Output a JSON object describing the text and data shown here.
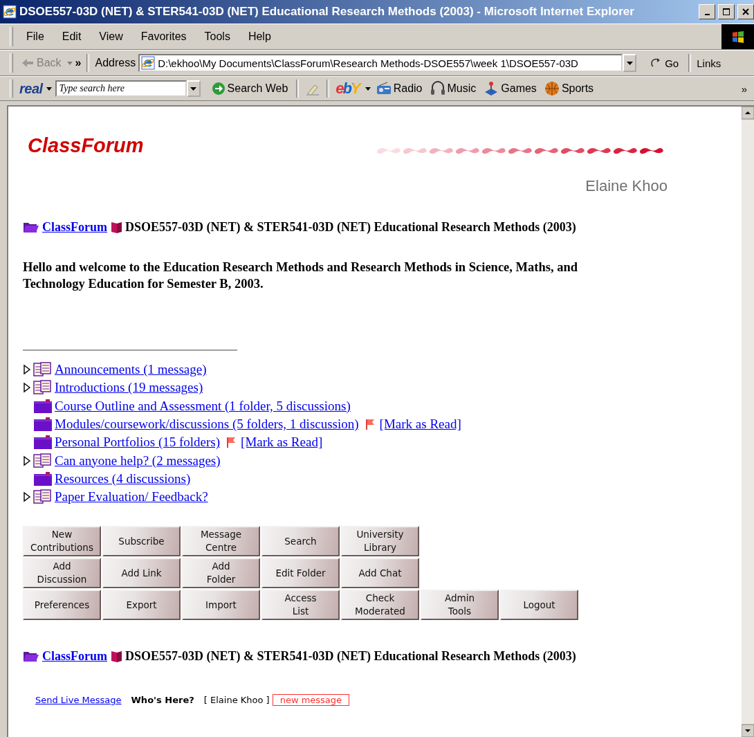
{
  "window": {
    "title": "DSOE557-03D (NET) & STER541-03D (NET) Educational Research Methods (2003) - Microsoft Internet Explorer"
  },
  "menu": [
    "File",
    "Edit",
    "View",
    "Favorites",
    "Tools",
    "Help"
  ],
  "address_bar": {
    "back": {
      "label": "Back",
      "disabled": true
    },
    "overflow": "»",
    "label": "Address",
    "value": "D:\\ekhoo\\My Documents\\ClassForum\\Research Methods-DSOE557\\week 1\\DSOE557-03D",
    "go": "Go",
    "links": "Links"
  },
  "search_toolbar": {
    "logo": "real",
    "search": {
      "placeholder": "Type search here"
    },
    "search_button": "Search Web",
    "ebay_logo": "ebY",
    "items": [
      {
        "label": "Radio",
        "kind": "radio"
      },
      {
        "label": "Music",
        "kind": "music"
      },
      {
        "label": "Games",
        "kind": "games"
      },
      {
        "label": "Sports",
        "kind": "sports"
      }
    ],
    "overflow": "»"
  },
  "page": {
    "logo": "ClassForum",
    "user": "Elaine Khoo",
    "breadcrumb_top": {
      "link": "ClassForum",
      "title": "DSOE557-03D (NET) & STER541-03D (NET) Educational Research Methods (2003)"
    },
    "welcome": "Hello and welcome to the Education Research Methods and Research Methods in Science, Maths, and Technology Education for Semester B, 2003.",
    "forums": [
      {
        "label": "Announcements (1 message)",
        "kind": "discussion",
        "flagged": false
      },
      {
        "label": "Introductions (19 messages)",
        "kind": "discussion",
        "flagged": false
      },
      {
        "label": "Course Outline and Assessment (1 folder, 5 discussions)",
        "kind": "folder",
        "flagged": false
      },
      {
        "label": "Modules/coursework/discussions (5 folders, 1 discussion)",
        "kind": "folder",
        "flagged": true,
        "mark_read": "[Mark as Read]"
      },
      {
        "label": "Personal Portfolios (15 folders)",
        "kind": "folder",
        "flagged": true,
        "mark_read": "[Mark as Read]"
      },
      {
        "label": "Can anyone help? (2 messages)",
        "kind": "discussion",
        "flagged": false
      },
      {
        "label": "Resources (4 discussions)",
        "kind": "folder",
        "flagged": false
      },
      {
        "label": "Paper Evaluation/ Feedback?",
        "kind": "discussion",
        "flagged": false
      }
    ],
    "button_rows": [
      [
        "New\nContributions",
        "Subscribe",
        "Message\nCentre",
        "Search",
        "University\nLibrary"
      ],
      [
        "Add\nDiscussion",
        "Add Link",
        "Add\nFolder",
        "Edit Folder",
        "Add Chat"
      ],
      [
        "Preferences",
        "Export",
        "Import",
        "Access\nList",
        "Check\nModerated",
        "Admin\nTools",
        "Logout"
      ]
    ],
    "breadcrumb_bottom": {
      "link": "ClassForum",
      "title": "DSOE557-03D (NET) & STER541-03D (NET) Educational Research Methods (2003)"
    },
    "footer": {
      "send_live_message": "Send Live Message",
      "whos_here": "Who's Here?",
      "online": "[ Elaine Khoo ]",
      "new_message": "new message"
    }
  }
}
